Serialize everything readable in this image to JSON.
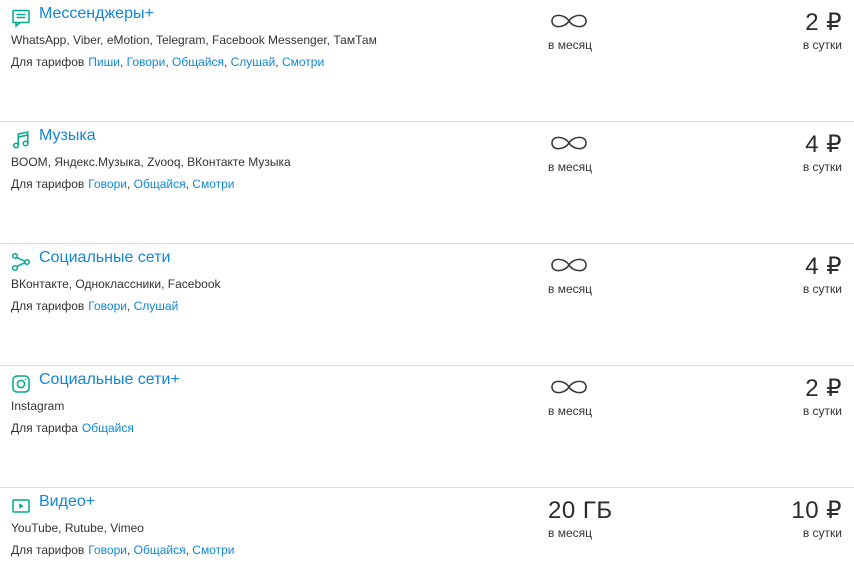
{
  "rows": [
    {
      "icon": "chat-icon",
      "title": "Мессенджеры+",
      "apps": "WhatsApp, Viber, eMotion, Telegram, Facebook Messenger, ТамТам",
      "tariffs_prefix": "Для тарифов",
      "tariffs": [
        "Пиши",
        "Говори",
        "Общайся",
        "Слушай",
        "Смотри"
      ],
      "volume": "∞",
      "unlimited": true,
      "period": "в месяц",
      "price": "2 ₽",
      "price_period": "в сутки"
    },
    {
      "icon": "music-note-icon",
      "title": "Музыка",
      "apps": "BOOM, Яндекс.Музыка, Zvooq, ВКонтакте Музыка",
      "tariffs_prefix": "Для тарифов",
      "tariffs": [
        "Говори",
        "Общайся",
        "Смотри"
      ],
      "volume": "∞",
      "unlimited": true,
      "period": "в месяц",
      "price": "4 ₽",
      "price_period": "в сутки"
    },
    {
      "icon": "share-nodes-icon",
      "title": "Социальные сети",
      "apps": "ВКонтакте, Одноклассники, Facebook",
      "tariffs_prefix": "Для тарифов",
      "tariffs": [
        "Говори",
        "Слушай"
      ],
      "volume": "∞",
      "unlimited": true,
      "period": "в месяц",
      "price": "4 ₽",
      "price_period": "в сутки"
    },
    {
      "icon": "instagram-icon",
      "title": "Социальные сети+",
      "apps": "Instagram",
      "tariffs_prefix": "Для тарифа",
      "tariffs": [
        "Общайся"
      ],
      "volume": "∞",
      "unlimited": true,
      "period": "в месяц",
      "price": "2 ₽",
      "price_period": "в сутки"
    },
    {
      "icon": "video-play-icon",
      "title": "Видео+",
      "apps": "YouTube, Rutube, Vimeo",
      "tariffs_prefix": "Для тарифов",
      "tariffs": [
        "Говори",
        "Общайся",
        "Смотри"
      ],
      "volume": "20 ГБ",
      "unlimited": false,
      "period": "в месяц",
      "price": "10 ₽",
      "price_period": "в сутки"
    }
  ],
  "colors": {
    "accent_green": "#00a88f",
    "link_blue": "#1187d9",
    "text_dark": "#333333",
    "divider": "#dedede"
  }
}
